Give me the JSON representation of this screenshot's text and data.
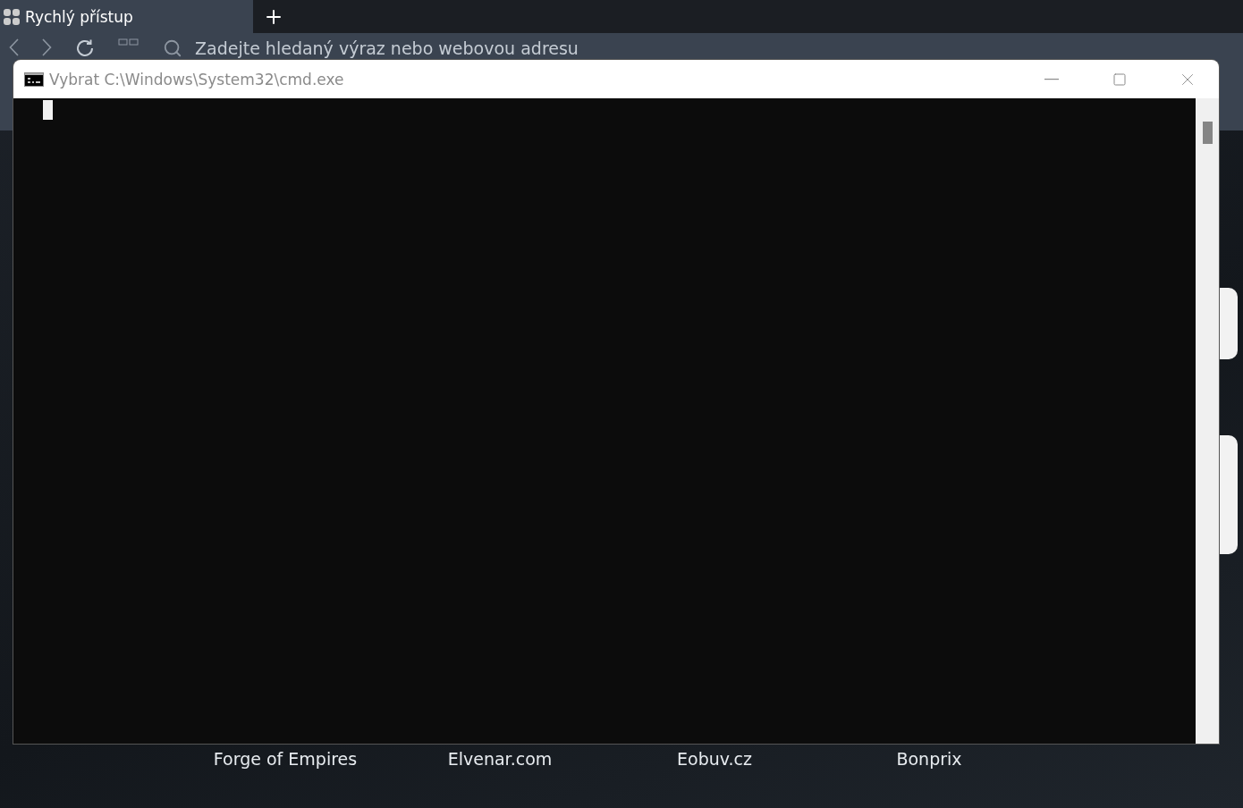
{
  "browser": {
    "tabs": [
      {
        "label": "Rychlý přístup",
        "selected": true
      }
    ],
    "address_bar": {
      "placeholder": "Zadejte hledaný výraz nebo webovou adresu"
    },
    "speed_dial": [
      {
        "label": "Forge of Empires"
      },
      {
        "label": "Elvenar.com"
      },
      {
        "label": "Eobuv.cz"
      },
      {
        "label": "Bonprix"
      }
    ]
  },
  "console_window": {
    "title": "Vybrat C:\\Windows\\System32\\cmd.exe"
  }
}
